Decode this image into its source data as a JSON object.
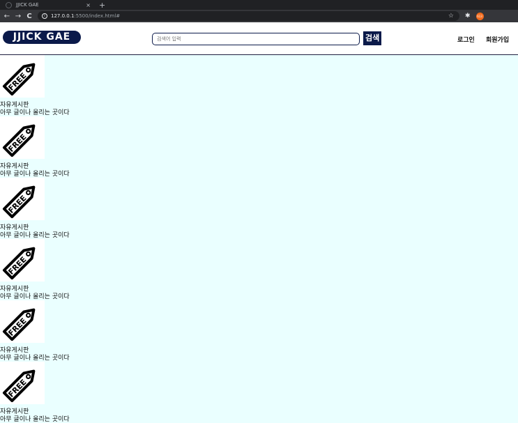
{
  "browser": {
    "tab_title": "JJICK GAE",
    "tab_close": "×",
    "new_tab": "+",
    "back": "←",
    "forward": "→",
    "reload": "C",
    "info": "i",
    "url_host": "127.0.0.1",
    "url_path": ":5500/index.html#",
    "star": "☆",
    "puzzle": "✱",
    "profile": "613"
  },
  "header": {
    "logo": "JJICK GAE",
    "search_placeholder": "검색어 입력",
    "search_button": "검색",
    "login": "로그인",
    "signup": "회원가입"
  },
  "board": {
    "tag_text": "FREE",
    "items": [
      {
        "title": "자유게시판",
        "desc": "아무 글이나 올리는 곳이다"
      },
      {
        "title": "자유게시판",
        "desc": "아무 글이나 올리는 곳이다"
      },
      {
        "title": "자유게시판",
        "desc": "아무 글이나 올리는 곳이다"
      },
      {
        "title": "자유게시판",
        "desc": "아무 글이나 올리는 곳이다"
      },
      {
        "title": "자유게시판",
        "desc": "아무 글이나 올리는 곳이다"
      },
      {
        "title": "자유게시판",
        "desc": "아무 글이나 올리는 곳이다"
      }
    ]
  },
  "colors": {
    "brand": "#0b1a4a",
    "page_background": "#eaffff"
  }
}
